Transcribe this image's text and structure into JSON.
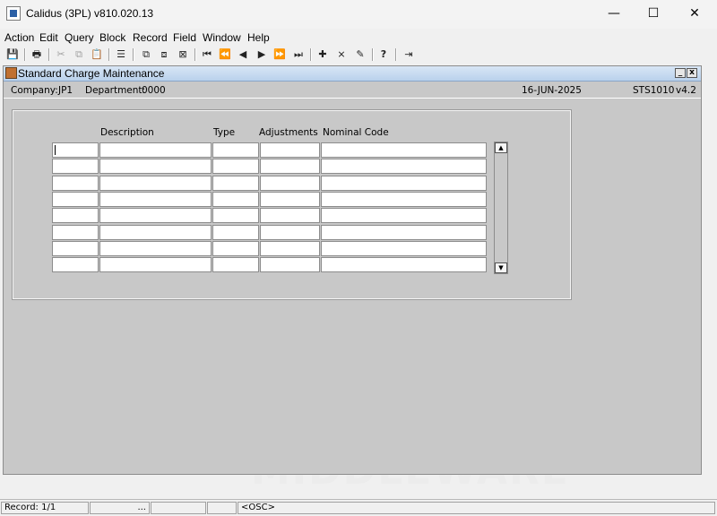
{
  "window": {
    "title": "Calidus (3PL) v810.020.13",
    "minimize": "—",
    "maximize": "☐",
    "close": "✕"
  },
  "menu": [
    "Action",
    "Edit",
    "Query",
    "Block",
    "Record",
    "Field",
    "Window",
    "Help"
  ],
  "toolbar_icons": [
    {
      "name": "save-icon",
      "glyph": "💾"
    },
    {
      "name": "print-icon",
      "glyph": "🖶"
    },
    {
      "name": "cut-icon",
      "glyph": "✂"
    },
    {
      "name": "copy-icon",
      "glyph": "⧉"
    },
    {
      "name": "paste-icon",
      "glyph": "📋"
    },
    {
      "name": "list-icon",
      "glyph": "☰"
    },
    {
      "name": "enter-query-icon",
      "glyph": "⧉"
    },
    {
      "name": "execute-query-icon",
      "glyph": "⧈"
    },
    {
      "name": "cancel-query-icon",
      "glyph": "⊠"
    },
    {
      "name": "first-record-icon",
      "glyph": "⏮"
    },
    {
      "name": "previous-block-icon",
      "glyph": "⏪"
    },
    {
      "name": "previous-record-icon",
      "glyph": "◀"
    },
    {
      "name": "next-record-icon",
      "glyph": "▶"
    },
    {
      "name": "next-block-icon",
      "glyph": "⏩"
    },
    {
      "name": "last-record-icon",
      "glyph": "⏭"
    },
    {
      "name": "insert-record-icon",
      "glyph": "✚"
    },
    {
      "name": "delete-record-icon",
      "glyph": "⨯"
    },
    {
      "name": "clear-record-icon",
      "glyph": "✎"
    },
    {
      "name": "help-icon",
      "glyph": "?"
    },
    {
      "name": "exit-icon",
      "glyph": "⇥"
    }
  ],
  "form": {
    "title": "Standard Charge Maintenance",
    "minimize": "_",
    "close": "x",
    "company_label": "Company:",
    "company_value": "JP1",
    "department_label": "Department:",
    "department_value": "0000",
    "date": "16-JUN-2025",
    "form_code": "STS1010",
    "version": "v4.2"
  },
  "grid": {
    "headers": [
      "Description",
      "Type",
      "Adjustments",
      "Nominal Code"
    ],
    "rows": 8
  },
  "scrollbar": {
    "up": "▲",
    "down": "▼"
  },
  "watermark": "MIDDLEWARE",
  "status": {
    "record": "Record: 1/1",
    "ellipsis": "...",
    "mode": "<OSC>"
  }
}
